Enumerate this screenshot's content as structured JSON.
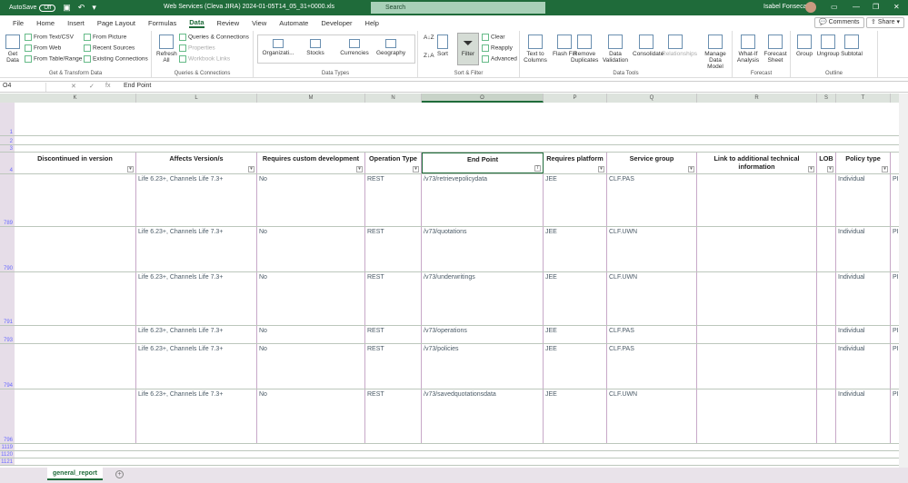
{
  "titlebar": {
    "autosave": "AutoSave",
    "autosave_state": "Off",
    "title": "Web Services (Cleva JIRA) 2024-01-05T14_05_31+0000.xls",
    "search": "Search",
    "user": "Isabel Fonseca"
  },
  "tabs": [
    "File",
    "Home",
    "Insert",
    "Page Layout",
    "Formulas",
    "Data",
    "Review",
    "View",
    "Automate",
    "Developer",
    "Help"
  ],
  "active_tab": "Data",
  "comments": "Comments",
  "share": "Share",
  "ribbon": {
    "get_transform": {
      "label": "Get & Transform Data",
      "get_data": "Get Data",
      "items": [
        "From Text/CSV",
        "From Web",
        "From Table/Range",
        "From Picture",
        "Recent Sources",
        "Existing Connections"
      ]
    },
    "queries": {
      "label": "Queries & Connections",
      "refresh": "Refresh All",
      "items": [
        "Queries & Connections",
        "Properties",
        "Workbook Links"
      ]
    },
    "data_types": {
      "label": "Data Types",
      "items": [
        "Organizati...",
        "Stocks",
        "Currencies",
        "Geography"
      ]
    },
    "sort_filter": {
      "label": "Sort & Filter",
      "sort": "Sort",
      "filter": "Filter",
      "items": [
        "Clear",
        "Reapply",
        "Advanced"
      ]
    },
    "data_tools": {
      "label": "Data Tools",
      "items": [
        "Text to Columns",
        "Flash Fill",
        "Remove Duplicates",
        "Data Validation",
        "Consolidate",
        "Relationships",
        "Manage Data Model"
      ]
    },
    "forecast": {
      "label": "Forecast",
      "items": [
        "What-If Analysis",
        "Forecast Sheet"
      ]
    },
    "outline": {
      "label": "Outline",
      "items": [
        "Group",
        "Ungroup",
        "Subtotal"
      ]
    }
  },
  "formula_bar": {
    "name_box": "O4",
    "value": "End Point"
  },
  "columns": [
    "K",
    "L",
    "M",
    "N",
    "O",
    "P",
    "Q",
    "R",
    "S",
    "T"
  ],
  "selected_column": "O",
  "header_row": {
    "row": "4",
    "cells": [
      "Discontinued in version",
      "Affects Version/s",
      "Requires custom development",
      "Operation Type",
      "End Point",
      "Requires platform",
      "Service group",
      "Link to additional technical information",
      "LOB",
      "Policy type"
    ]
  },
  "top_rows": [
    "1",
    "2",
    "3"
  ],
  "rows": [
    {
      "row": "789",
      "cells": [
        "",
        "Life 6.23+, Channels Life 7.3+",
        "No",
        "REST",
        "/v73/retrievepolicydata",
        "JEE",
        "CLF.PAS",
        "",
        "",
        "Individual",
        "PI"
      ]
    },
    {
      "row": "790",
      "cells": [
        "",
        "Life 6.23+, Channels Life 7.3+",
        "No",
        "REST",
        "/v73/quotations",
        "JEE",
        "CLF.UWN",
        "",
        "",
        "Individual",
        "PI"
      ]
    },
    {
      "row": "791",
      "cells": [
        "",
        "Life 6.23+, Channels Life 7.3+",
        "No",
        "REST",
        "/v73/underwritings",
        "JEE",
        "CLF.UWN",
        "",
        "",
        "Individual",
        "PI"
      ]
    },
    {
      "row": "793",
      "cells": [
        "",
        "Life 6.23+, Channels Life 7.3+",
        "No",
        "REST",
        "/v73/operations",
        "JEE",
        "CLF.PAS",
        "",
        "",
        "Individual",
        "PI"
      ]
    },
    {
      "row": "794",
      "cells": [
        "",
        "Life 6.23+, Channels Life 7.3+",
        "No",
        "REST",
        "/v73/policies",
        "JEE",
        "CLF.PAS",
        "",
        "",
        "Individual",
        "PI"
      ]
    },
    {
      "row": "796",
      "cells": [
        "",
        "Life 6.23+, Channels Life 7.3+",
        "No",
        "REST",
        "/v73/savedquotationsdata",
        "JEE",
        "CLF.UWN",
        "",
        "",
        "Individual",
        "PI"
      ]
    }
  ],
  "bottom_rows": [
    "1119",
    "1120",
    "1121"
  ],
  "sheet_tab": "general_report"
}
